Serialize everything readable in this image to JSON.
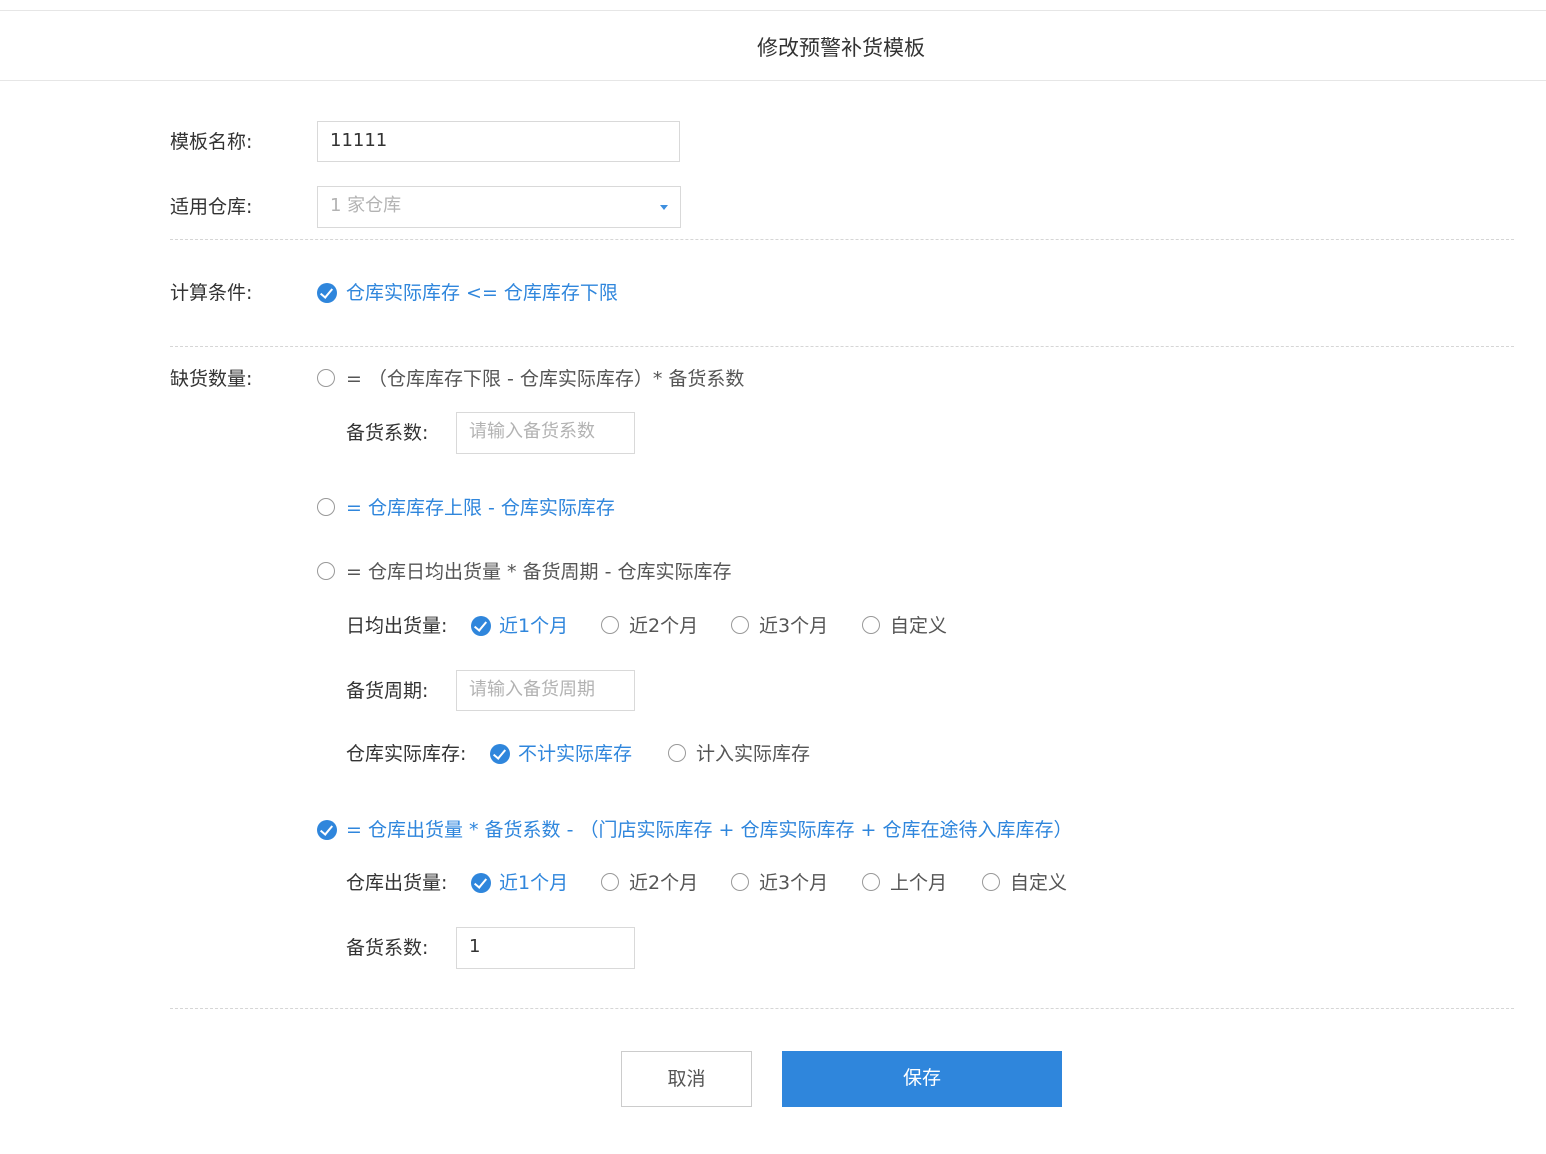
{
  "dialog": {
    "title": "修改预警补货模板"
  },
  "form": {
    "template_name": {
      "label": "模板名称:",
      "value": "11111"
    },
    "warehouse": {
      "label": "适用仓库:",
      "value": "1 家仓库"
    },
    "calc_condition": {
      "label": "计算条件:",
      "option": "仓库实际库存 <= 仓库库存下限",
      "checked": true
    },
    "shortage": {
      "label": "缺货数量:",
      "option1": {
        "text": "= （仓库库存下限 - 仓库实际库存）* 备货系数",
        "coef_label": "备货系数:",
        "coef_placeholder": "请输入备货系数"
      },
      "option2": {
        "text": "= 仓库库存上限 - 仓库实际库存"
      },
      "option3": {
        "text": "= 仓库日均出货量 * 备货周期 - 仓库实际库存",
        "daily_label": "日均出货量:",
        "daily_options": [
          "近1个月",
          "近2个月",
          "近3个月",
          "自定义"
        ],
        "daily_selected": "近1个月",
        "period_label": "备货周期:",
        "period_placeholder": "请输入备货周期",
        "stock_label": "仓库实际库存:",
        "stock_options": [
          "不计实际库存",
          "计入实际库存"
        ],
        "stock_selected": "不计实际库存"
      },
      "option4": {
        "text": "= 仓库出货量 * 备货系数 - （门店实际库存 + 仓库实际库存 + 仓库在途待入库库存）",
        "checked": true,
        "out_label": "仓库出货量:",
        "out_options": [
          "近1个月",
          "近2个月",
          "近3个月",
          "上个月",
          "自定义"
        ],
        "out_selected": "近1个月",
        "coef_label": "备货系数:",
        "coef_value": "1"
      }
    }
  },
  "buttons": {
    "cancel": "取消",
    "save": "保存"
  },
  "colors": {
    "accent": "#2f86dc",
    "border": "#d9d9d9",
    "placeholder": "#b3b3b3"
  }
}
